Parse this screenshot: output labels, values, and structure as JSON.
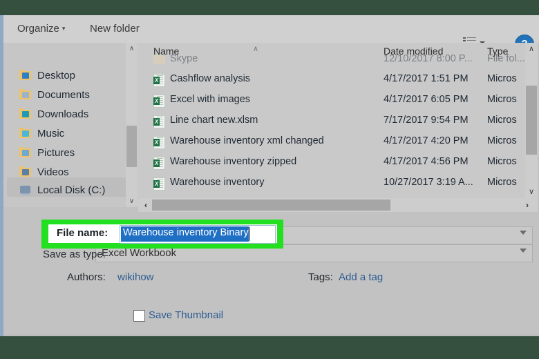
{
  "window": {
    "chrome_color": "#36503f",
    "dialog_bg": "#c2c2c2"
  },
  "toolbar": {
    "organize_label": "Organize",
    "organize_caret": "▾",
    "new_folder_label": "New folder",
    "view_icon_name": "details-view-icon",
    "view_caret": "▾",
    "help_label": "?"
  },
  "navigation": {
    "items": [
      {
        "label": "Desktop",
        "icon": "folder-desktop-icon",
        "badge_color": "#2f7fc4",
        "selected": false
      },
      {
        "label": "Documents",
        "icon": "folder-documents-icon",
        "badge_color": "#8fa6bd",
        "selected": false
      },
      {
        "label": "Downloads",
        "icon": "folder-downloads-icon",
        "badge_color": "#1f9ab5",
        "selected": false
      },
      {
        "label": "Music",
        "icon": "folder-music-icon",
        "badge_color": "#4db6d6",
        "selected": false
      },
      {
        "label": "Pictures",
        "icon": "folder-pictures-icon",
        "badge_color": "#6fa8d0",
        "selected": false
      },
      {
        "label": "Videos",
        "icon": "folder-videos-icon",
        "badge_color": "#5c7fa6",
        "selected": false
      },
      {
        "label": "Local Disk (C:)",
        "icon": "local-disk-icon",
        "badge_color": "",
        "selected": true
      }
    ],
    "scrollbar": {
      "up": "∧",
      "down": "∨"
    }
  },
  "file_list": {
    "columns": {
      "name": "Name",
      "date_modified": "Date modified",
      "type": "Type",
      "sort_indicator": "∧"
    },
    "clipped_row": {
      "name": "Skype",
      "date": "12/10/2017 8:00 P...",
      "type": "File fol..."
    },
    "rows": [
      {
        "name": "Cashflow analysis",
        "date": "4/17/2017 1:51 PM",
        "type": "Micros",
        "icon": "excel-file-icon"
      },
      {
        "name": "Excel with images",
        "date": "4/17/2017 6:05 PM",
        "type": "Micros",
        "icon": "excel-file-icon"
      },
      {
        "name": "Line chart new.xlsm",
        "date": "7/17/2017 9:54 PM",
        "type": "Micros",
        "icon": "excel-file-icon"
      },
      {
        "name": "Warehouse inventory xml changed",
        "date": "4/17/2017 4:20 PM",
        "type": "Micros",
        "icon": "excel-file-icon"
      },
      {
        "name": "Warehouse inventory zipped",
        "date": "4/17/2017 4:56 PM",
        "type": "Micros",
        "icon": "excel-file-icon"
      },
      {
        "name": "Warehouse inventory",
        "date": "10/27/2017 3:19 A...",
        "type": "Micros",
        "icon": "excel-file-icon"
      }
    ],
    "vscroll": {
      "up": "∧",
      "down": "∨"
    },
    "hscroll": {
      "left": "‹",
      "right": "›"
    }
  },
  "form": {
    "file_name_label": "File name:",
    "file_name_value": "Warehouse inventory Binary",
    "save_as_type_label": "Save as type:",
    "save_as_type_value": "Excel Workbook",
    "authors_label": "Authors:",
    "authors_value": "wikihow",
    "tags_label": "Tags:",
    "tags_value": "Add a tag",
    "save_thumbnail_label": "Save Thumbnail",
    "save_thumbnail_checked": false,
    "highlight_color": "#22e020",
    "selection_color": "#1f6fc4",
    "link_color": "#2c5c91"
  }
}
